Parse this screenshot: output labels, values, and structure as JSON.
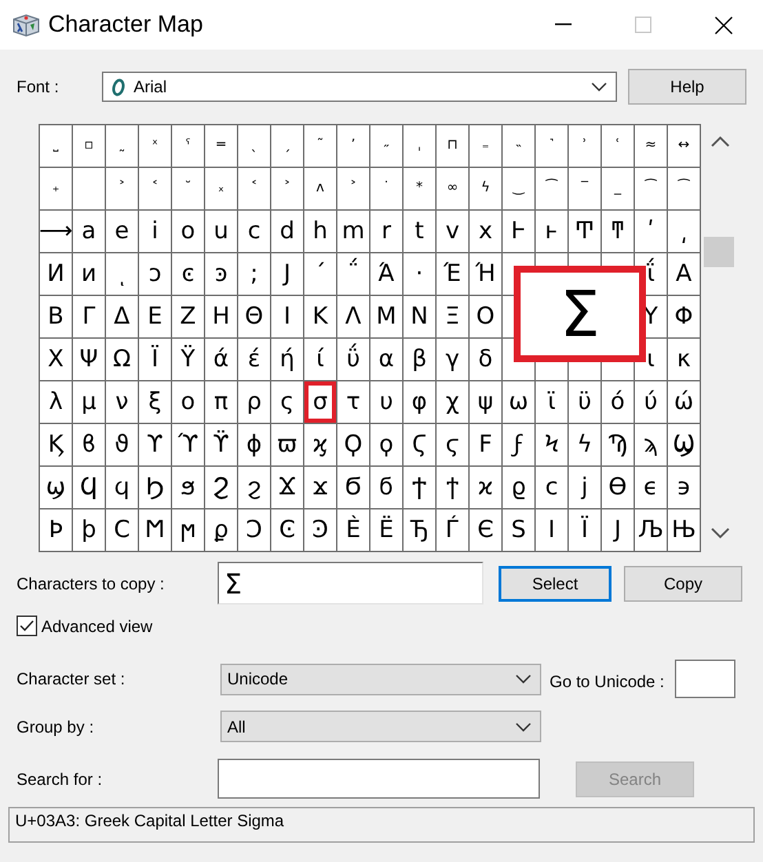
{
  "window": {
    "title": "Character Map"
  },
  "font": {
    "label": "Font :",
    "value": "Arial"
  },
  "help_button": "Help",
  "grid": {
    "rows": [
      {
        "kind": "marks",
        "cells": [
          "˽",
          "▫",
          "˷",
          "ˣ",
          "ˤ",
          "═",
          "ˎ",
          "ˏ",
          "˜",
          "ʼ",
          "˶",
          "ˌ",
          "⊓",
          "₌",
          "˵",
          "˺",
          "ʾ",
          "ʿ",
          "≈",
          "↔"
        ]
      },
      {
        "kind": "marks",
        "cells": [
          "₊",
          null,
          "˃",
          "˂",
          "˘",
          "ₓ",
          "˂",
          "˃",
          "ʌ",
          "˃",
          "˙",
          "*",
          "∞",
          "ϟ",
          "‿",
          "⁀",
          "‾",
          "_",
          "⁀",
          "⁀"
        ]
      },
      {
        "kind": "letters",
        "cells": [
          "⟶",
          "a",
          "e",
          "i",
          "o",
          "u",
          "c",
          "d",
          "h",
          "m",
          "r",
          "t",
          "v",
          "x",
          "Ͱ",
          "ͱ",
          "Ͳ",
          "ͳ",
          "ʹ",
          "͵"
        ]
      },
      {
        "kind": "letters",
        "cells": [
          "Ͷ",
          "ͷ",
          "ͺ",
          "ͻ",
          "ͼ",
          "ͽ",
          ";",
          "Ϳ",
          "΄",
          "΅",
          "Ά",
          "·",
          "Έ",
          "Ή",
          null,
          null,
          null,
          null,
          "ΐ",
          "Α"
        ]
      },
      {
        "kind": "letters",
        "cells": [
          "Β",
          "Γ",
          "Δ",
          "Ε",
          "Ζ",
          "Η",
          "Θ",
          "Ι",
          "Κ",
          "Λ",
          "Μ",
          "Ν",
          "Ξ",
          "Ο",
          null,
          null,
          null,
          null,
          "Υ",
          "Φ"
        ]
      },
      {
        "kind": "letters",
        "cells": [
          "Χ",
          "Ψ",
          "Ω",
          "Ϊ",
          "Ϋ",
          "ά",
          "έ",
          "ή",
          "ί",
          "ΰ",
          "α",
          "β",
          "γ",
          "δ",
          null,
          null,
          null,
          null,
          "ι",
          "κ"
        ]
      },
      {
        "kind": "letters",
        "cells": [
          "λ",
          "μ",
          "ν",
          "ξ",
          "ο",
          "π",
          "ρ",
          "ς",
          {
            "char": "σ",
            "marked": true
          },
          "τ",
          "υ",
          "φ",
          "χ",
          "ψ",
          "ω",
          "ϊ",
          "ϋ",
          "ό",
          "ύ",
          "ώ"
        ]
      },
      {
        "kind": "letters",
        "cells": [
          "Ϗ",
          "ϐ",
          "ϑ",
          "ϒ",
          "ϓ",
          "ϔ",
          "ϕ",
          "ϖ",
          "ϗ",
          "Ϙ",
          "ϙ",
          "Ϛ",
          "ϛ",
          "Ϝ",
          "ϝ",
          "Ϟ",
          "ϟ",
          "Ϡ",
          "ϡ",
          "Ϣ"
        ]
      },
      {
        "kind": "letters",
        "cells": [
          "ϣ",
          "Ϥ",
          "ϥ",
          "Ϧ",
          "ϧ",
          "Ϩ",
          "ϩ",
          "Ϫ",
          "ϫ",
          "Ϭ",
          "ϭ",
          "Ϯ",
          "ϯ",
          "ϰ",
          "ϱ",
          "ϲ",
          "ϳ",
          "ϴ",
          "ϵ",
          "϶"
        ]
      },
      {
        "kind": "letters",
        "cells": [
          "Ϸ",
          "ϸ",
          "Ϲ",
          "Ϻ",
          "ϻ",
          "ϼ",
          "Ͻ",
          "Ͼ",
          "Ͽ",
          "Ѐ",
          "Ё",
          "Ђ",
          "Ѓ",
          "Є",
          "Ѕ",
          "І",
          "Ї",
          "Ј",
          "Љ",
          "Њ"
        ]
      }
    ],
    "popup": "Σ"
  },
  "copy": {
    "label": "Characters to copy :",
    "value": "Σ",
    "select_button": "Select",
    "copy_button": "Copy"
  },
  "advanced_view": {
    "label": "Advanced view",
    "checked": true
  },
  "character_set": {
    "label": "Character set :",
    "value": "Unicode"
  },
  "go_to_unicode": {
    "label": "Go to Unicode :"
  },
  "group_by": {
    "label": "Group by :",
    "value": "All"
  },
  "search": {
    "label": "Search for :",
    "button": "Search",
    "disabled": true
  },
  "status_bar": "U+03A3: Greek Capital Letter Sigma"
}
